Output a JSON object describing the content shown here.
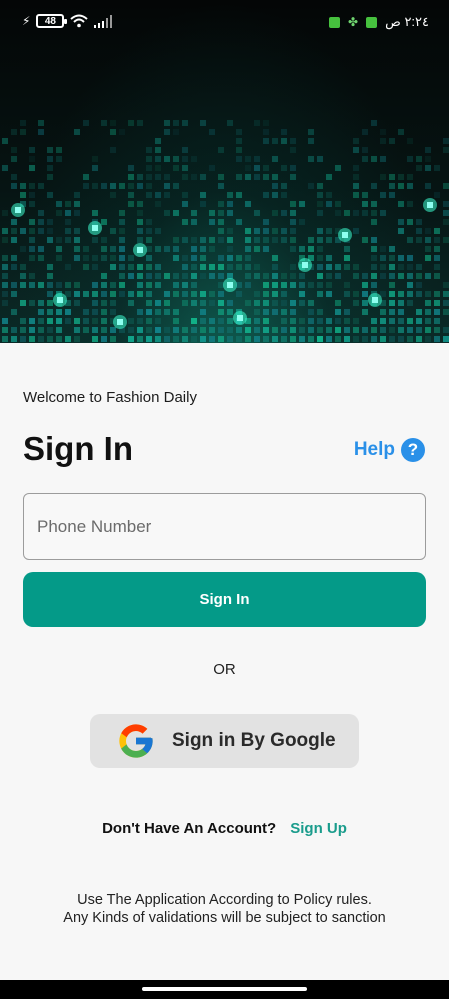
{
  "status_bar": {
    "battery": "48",
    "time": "٢:٢٤ ص"
  },
  "content": {
    "welcome": "Welcome to Fashion Daily",
    "title": "Sign In",
    "help_label": "Help",
    "help_icon_glyph": "?",
    "phone_placeholder": "Phone Number",
    "signin_label": "Sign In",
    "or_label": "OR",
    "google_label": "Sign in By Google",
    "account_question": "Don't Have An Account?",
    "signup_label": "Sign Up",
    "policy_line1": "Use The Application According to Policy rules.",
    "policy_line2": "Any Kinds of validations will be subject to sanction"
  },
  "colors": {
    "primary": "#049a88",
    "help_blue": "#2a90e8",
    "signup_teal": "#1a9c8c"
  },
  "icons": [
    "charging-icon",
    "battery-icon",
    "wifi-icon",
    "signal-icon",
    "help-icon",
    "google-icon"
  ]
}
